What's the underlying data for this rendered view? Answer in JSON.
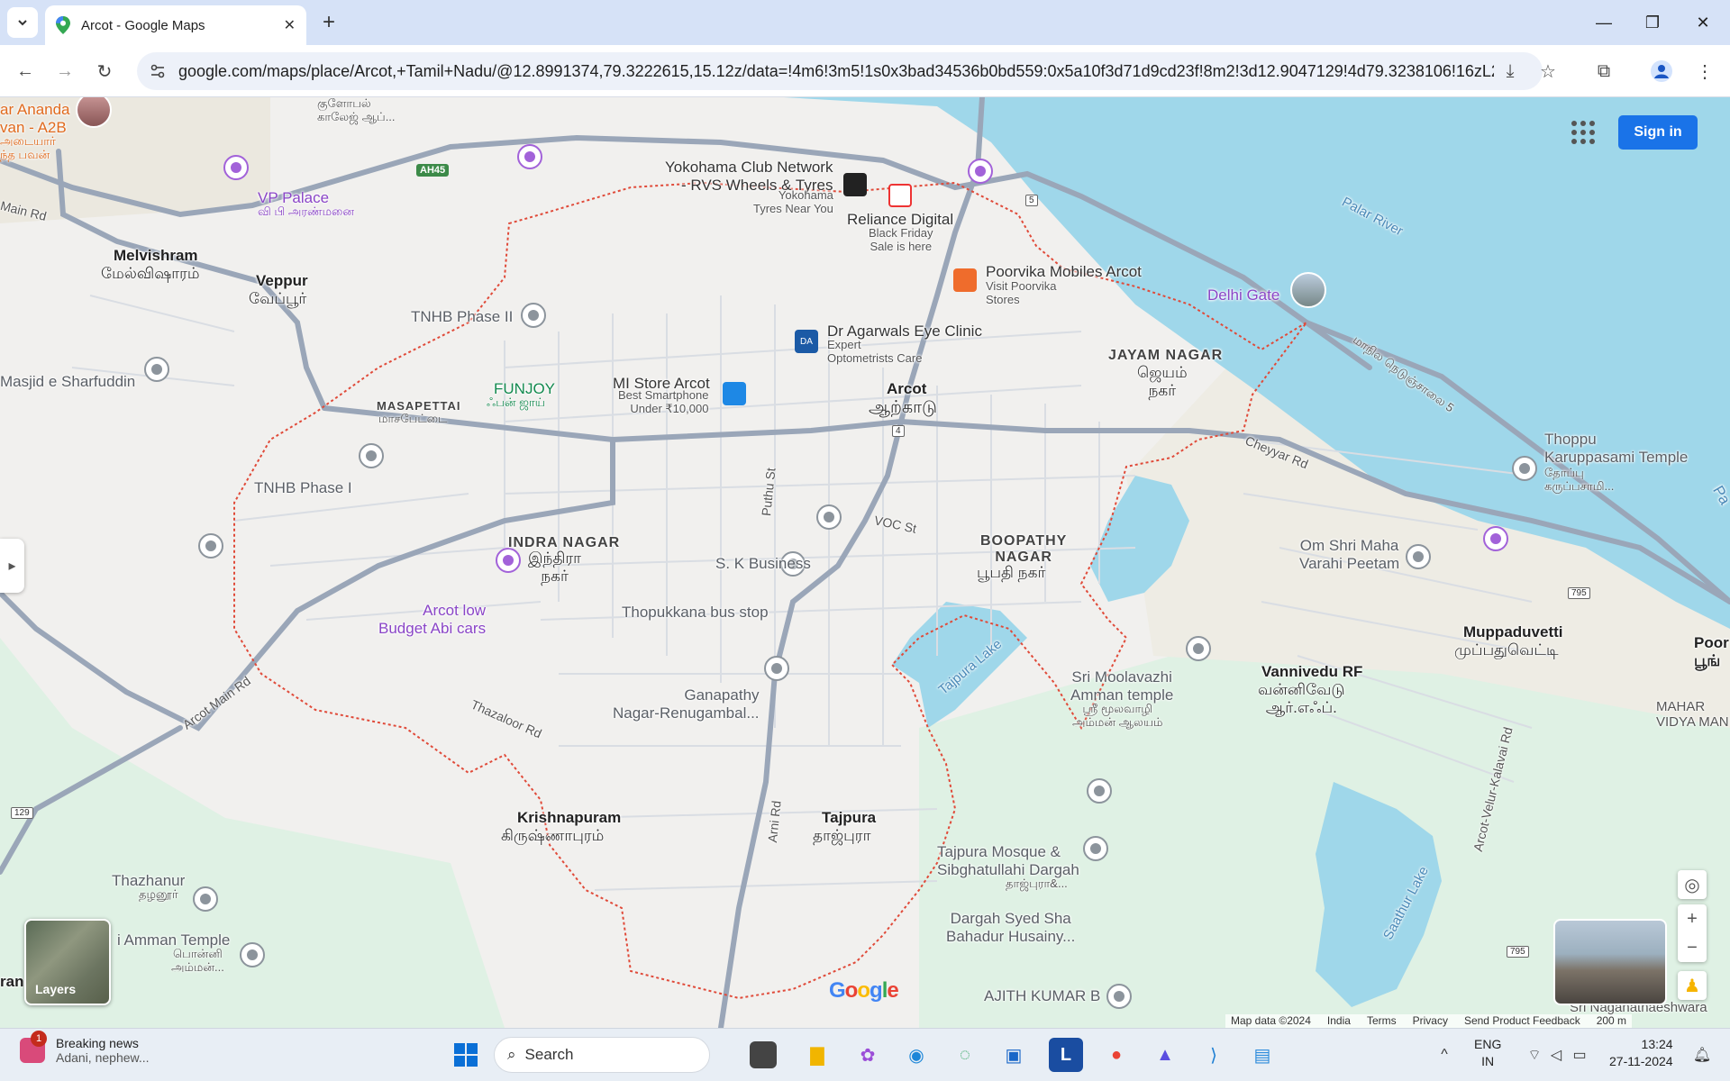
{
  "browser": {
    "tab_title": "Arcot - Google Maps",
    "url": "google.com/maps/place/Arcot,+Tamil+Nadu/@12.8991374,79.3222615,15.12z/data=!4m6!3m5!1s0x3bad34536b0bd559:0x5a10f3d71d9cd23f!8m2!3d12.9047129!4d79.3238106!16zL20vM..."
  },
  "map": {
    "sign_in": "Sign in",
    "layers_label": "Layers",
    "google_logo": "Google",
    "attribution": [
      "Map data ©2024",
      "India",
      "Terms",
      "Privacy",
      "Send Product Feedback",
      "200 m"
    ],
    "labels": {
      "ananda": "ar Ananda\nvan - A2B",
      "ananda_ta": "அடையார்\nந்த பவன்",
      "college": "குளோபல்\nகாலேஜ் ஆப்...",
      "vp_palace": "VP Palace",
      "vp_palace_ta": "வி பி அரண்மனை",
      "main_rd": "Main Rd",
      "melvishram": "Melvishram",
      "melvishram_ta": "மேல்விஷாரம்",
      "veppur": "Veppur",
      "veppur_ta": "வேப்பூர்",
      "masjid": "Masjid e Sharfuddin",
      "tnhb2": "TNHB Phase II",
      "tnhb1": "TNHB Phase I",
      "masapettai": "MASAPETTAI",
      "masapettai_ta": "மாசபேட்டை",
      "funjoy": "FUNJOY",
      "funjoy_ta": "ஃபன் ஜாய்",
      "yokohama": "Yokohama Club Network\n- RVS Wheels & Tyres",
      "yokohama_sub": "Yokohama\nTyres Near You",
      "reliance": "Reliance Digital",
      "reliance_sub": "Black Friday\nSale is here",
      "poorvika": "Poorvika Mobiles Arcot",
      "poorvika_sub": "Visit Poorvika\nStores",
      "agarwals": "Dr Agarwals Eye Clinic",
      "agarwals_sub": "Expert\nOptometrists Care",
      "mistore": "MI Store Arcot",
      "mistore_sub": "Best Smartphone\nUnder ₹10,000",
      "arcot": "Arcot",
      "arcot_ta": "ஆற்காடு",
      "delhi_gate": "Delhi Gate",
      "jayam": "JAYAM NAGAR",
      "jayam_ta": "ஜெயம்\nநகர்",
      "palar": "Palar River",
      "nh5": "மாநில நெடுஞ்சாலை 5",
      "cheyyar": "Cheyyar Rd",
      "thoppu": "Thoppu\nKaruppasami Temple",
      "thoppu_ta": "தோப்பு\nகருப்பசாமி...",
      "indra": "INDRA NAGAR",
      "indra_ta": "இந்திரா\nநகர்",
      "puthu": "Puthu St",
      "voc": "VOC St",
      "sk": "S. K Business",
      "boopathy": "BOOPATHY\nNAGAR",
      "boopathy_ta": "பூபதி நகர்",
      "omshri": "Om Shri Maha\nVarahi Peetam",
      "arcotlow": "Arcot low\nBudget Abi cars",
      "thopukkana": "Thopukkana bus stop",
      "muppaduvetti": "Muppaduvetti",
      "muppaduvetti_ta": "முப்பதுவெட்டி",
      "main_rd2": "Arcot Main Rd",
      "tajpura_lake": "Tajpura Lake",
      "moolavazhi": "Sri Moolavazhi\nAmman temple",
      "moolavazhi_ta": "ஸ்ரீ மூலவாழி\nஅம்மன் ஆலயம்",
      "vannivedu": "Vannivedu RF",
      "vannivedu_ta": "வன்னிவேடு\nஆர்.எஃப்.",
      "ganapathy": "Ganapathy\nNagar-Renugambal...",
      "thazaloor": "Thazaloor Rd",
      "krishnapuram": "Krishnapuram",
      "krishnapuram_ta": "கிருஷ்ணாபுரம்",
      "tajpura": "Tajpura",
      "tajpura_ta": "தாஜ்புரா",
      "arni": "Arni Rd",
      "mosque": "Tajpura Mosque &\nSibghatullahi Dargah",
      "mosque_ta": "தாஜ்புரா&...",
      "dargah": "Dargah Syed Sha\nBahadur Husainy...",
      "ajith": "AJITH KUMAR B",
      "thazhanur": "Thazhanur",
      "thazhanur_ta": "தழனூர்",
      "amman": "i Amman Temple",
      "amman_ta": "பொன்னி\nஅம்மன்...",
      "velur": "Arcot-Velur-Kalavai Rd",
      "saathur": "Saathur Lake",
      "poo": "Poor\nபூங்",
      "mahar": "MAHAR\nVIDYA MAN",
      "pa": "Pa",
      "naga": "Sri Naganathaeshwara",
      "ran": "ran"
    },
    "shields": {
      "ah45": "AH45",
      "s5": "5",
      "s4": "4",
      "s795a": "795",
      "s795b": "795",
      "s129": "129"
    }
  },
  "taskbar": {
    "news_title": "Breaking news",
    "news_sub": "Adani, nephew...",
    "news_badge": "1",
    "search": "Search",
    "lang1": "ENG",
    "lang2": "IN",
    "time": "13:24",
    "date": "27-11-2024"
  }
}
